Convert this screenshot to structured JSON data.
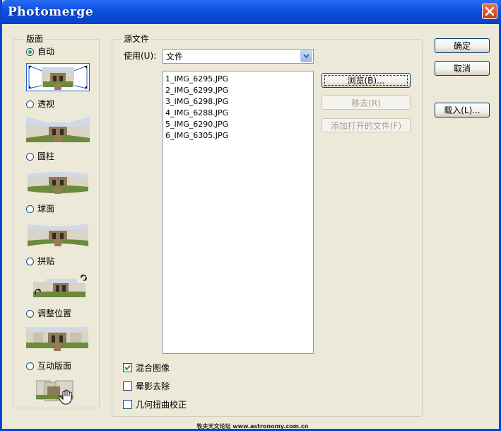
{
  "window": {
    "title": "Photomerge"
  },
  "layout_group": {
    "label": "版面",
    "options": [
      {
        "label": "自动",
        "checked": true
      },
      {
        "label": "透视",
        "checked": false
      },
      {
        "label": "圆柱",
        "checked": false
      },
      {
        "label": "球面",
        "checked": false
      },
      {
        "label": "拼贴",
        "checked": false
      },
      {
        "label": "调整位置",
        "checked": false
      },
      {
        "label": "互动版面",
        "checked": false
      }
    ]
  },
  "source_group": {
    "label": "源文件",
    "use_label": "使用(U):",
    "use_value": "文件",
    "files": [
      "1_IMG_6295.JPG",
      "2_IMG_6299.JPG",
      "3_IMG_6298.JPG",
      "4_IMG_6288.JPG",
      "5_IMG_6290.JPG",
      "6_IMG_6305.JPG"
    ],
    "browse_label": "浏览(B)...",
    "remove_label": "移去(R)",
    "add_open_label": "添加打开的文件(F)"
  },
  "options": [
    {
      "label": "混合图像",
      "checked": true
    },
    {
      "label": "晕影去除",
      "checked": false
    },
    {
      "label": "几何扭曲校正",
      "checked": false
    }
  ],
  "buttons": {
    "ok": "确定",
    "cancel": "取消",
    "load": "载入(L)..."
  },
  "footer": "牧夫天文论坛 www.astronomy.com.cn",
  "colors": {
    "titlebar": "#0a4fe0",
    "dialog_bg": "#ece9d8",
    "close": "#c2401f"
  }
}
